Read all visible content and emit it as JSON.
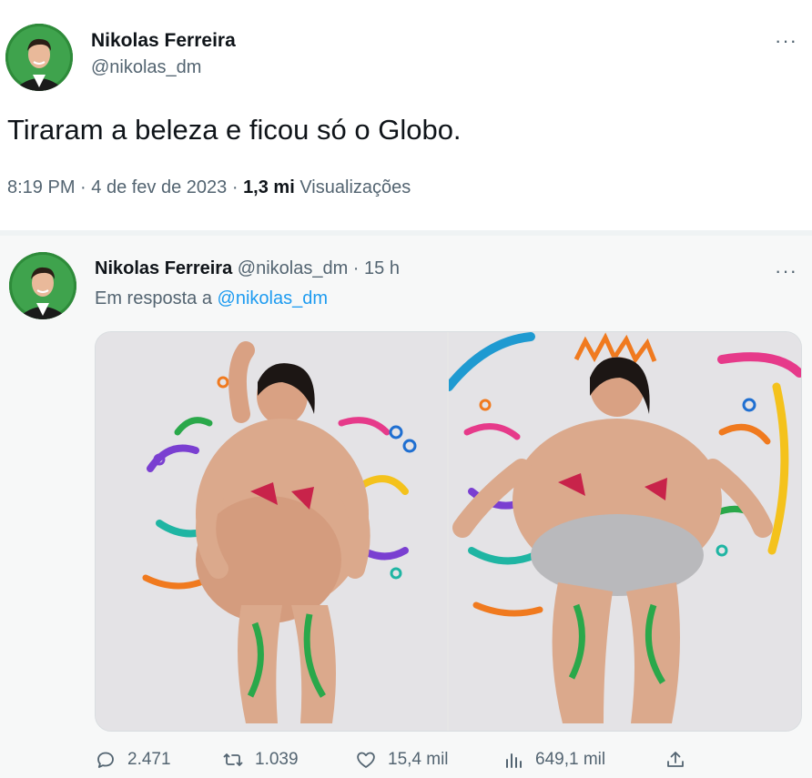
{
  "main_tweet": {
    "author_name": "Nikolas Ferreira",
    "author_handle": "@nikolas_dm",
    "more_label": "···",
    "text": "Tiraram a beleza e ficou só o Globo.",
    "time": "8:19 PM",
    "separator": " · ",
    "date": "4 de fev de 2023",
    "views_count": "1,3 mi",
    "views_label": "Visualizações"
  },
  "quoted_tweet": {
    "author_name": "Nikolas Ferreira",
    "author_handle": "@nikolas_dm",
    "separator": " · ",
    "age": "15 h",
    "more_label": "···",
    "reply_prefix": "Em resposta a",
    "reply_handle": "@nikolas_dm",
    "actions": {
      "replies": "2.471",
      "retweets": "1.039",
      "likes": "15,4 mil",
      "views": "649,1 mil"
    }
  },
  "icons": {
    "reply": "reply-icon",
    "retweet": "retweet-icon",
    "like": "heart-icon",
    "views": "analytics-icon",
    "share": "share-icon"
  },
  "colors": {
    "link": "#1d9bf0",
    "muted": "#536471",
    "text": "#0f1419",
    "quoted_bg": "#f7f8f8"
  }
}
